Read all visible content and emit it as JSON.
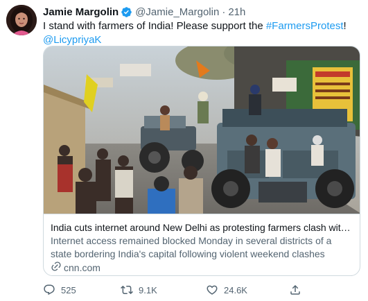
{
  "tweet": {
    "author": {
      "display_name": "Jamie Margolin",
      "handle": "@Jamie_Margolin",
      "verified_icon": "verified-badge-icon",
      "avatar": "profile-avatar"
    },
    "separator": "·",
    "timestamp": "21h",
    "text": {
      "part1": "I stand with farmers of India! Please support the ",
      "hashtag": "#FarmersProtest",
      "part2": "!",
      "mention": "@LicypriyaK"
    },
    "card": {
      "title": "India cuts internet around New Delhi as protesting farmers clash with p...",
      "description": "Internet access remained blocked Monday in several districts of a state bordering India's capital following violent weekend clashes between ...",
      "domain": "cnn.com",
      "link_icon": "link-icon"
    },
    "actions": {
      "replies": "525",
      "retweets": "9.1K",
      "likes": "24.6K",
      "reply_icon": "reply-icon",
      "retweet_icon": "retweet-icon",
      "like_icon": "heart-icon",
      "share_icon": "share-icon"
    },
    "colors": {
      "link": "#1d9bf0",
      "secondary_text": "#536471",
      "border": "#cfd9de"
    }
  }
}
